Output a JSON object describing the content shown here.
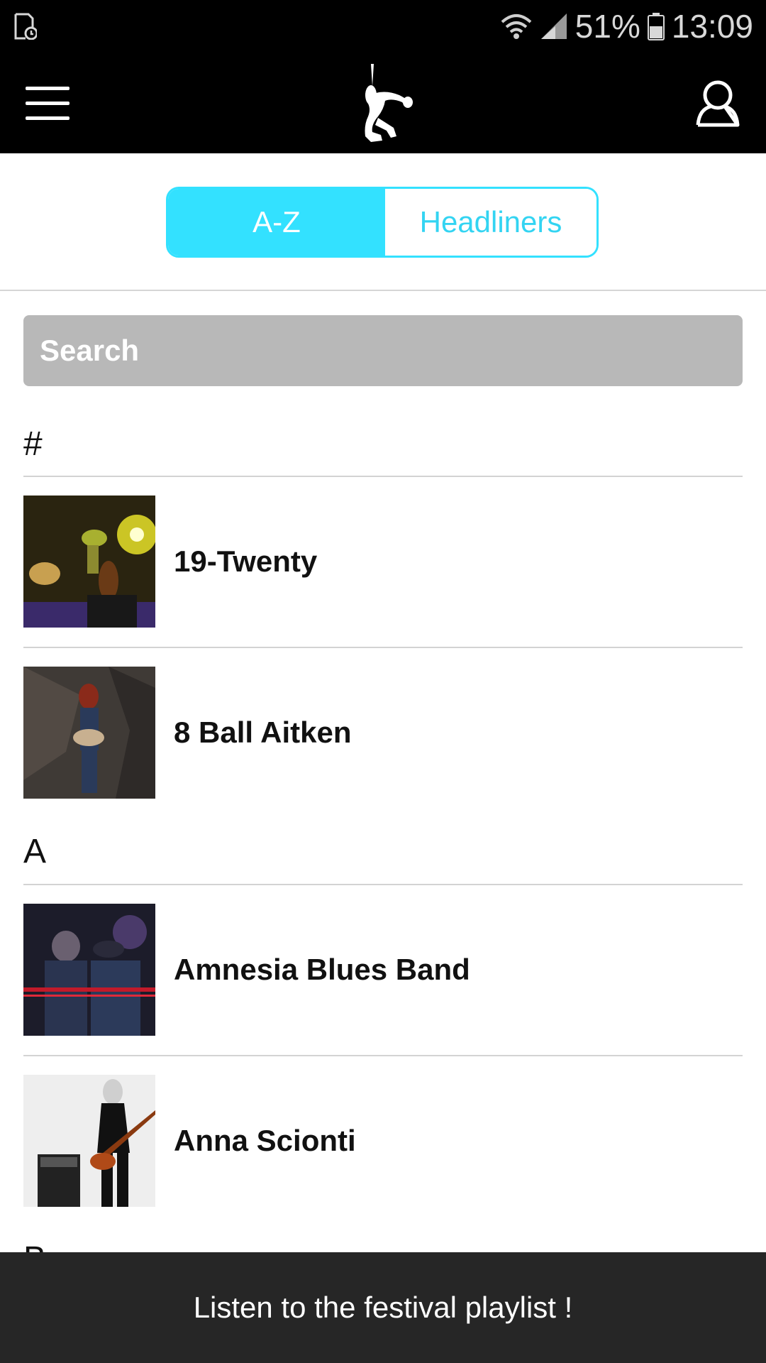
{
  "status_bar": {
    "battery": "51%",
    "time": "13:09",
    "icons": [
      "screen-record-icon",
      "wifi-icon",
      "signal-icon",
      "battery-icon"
    ]
  },
  "header": {
    "icons": [
      "hamburger-menu-icon",
      "guitarist-logo-icon",
      "user-profile-icon"
    ]
  },
  "tabs": {
    "az_label": "A-Z",
    "headliners_label": "Headliners",
    "active": "A-Z",
    "accent_color": "#33e1ff"
  },
  "search": {
    "placeholder": "Search"
  },
  "sections": [
    {
      "letter": "#",
      "artists": [
        "19-Twenty",
        "8 Ball Aitken"
      ]
    },
    {
      "letter": "A",
      "artists": [
        "Amnesia Blues Band",
        "Anna Scionti"
      ]
    },
    {
      "letter": "B",
      "artists": []
    }
  ],
  "footer": {
    "playlist_label": "Listen to the festival playlist !"
  }
}
